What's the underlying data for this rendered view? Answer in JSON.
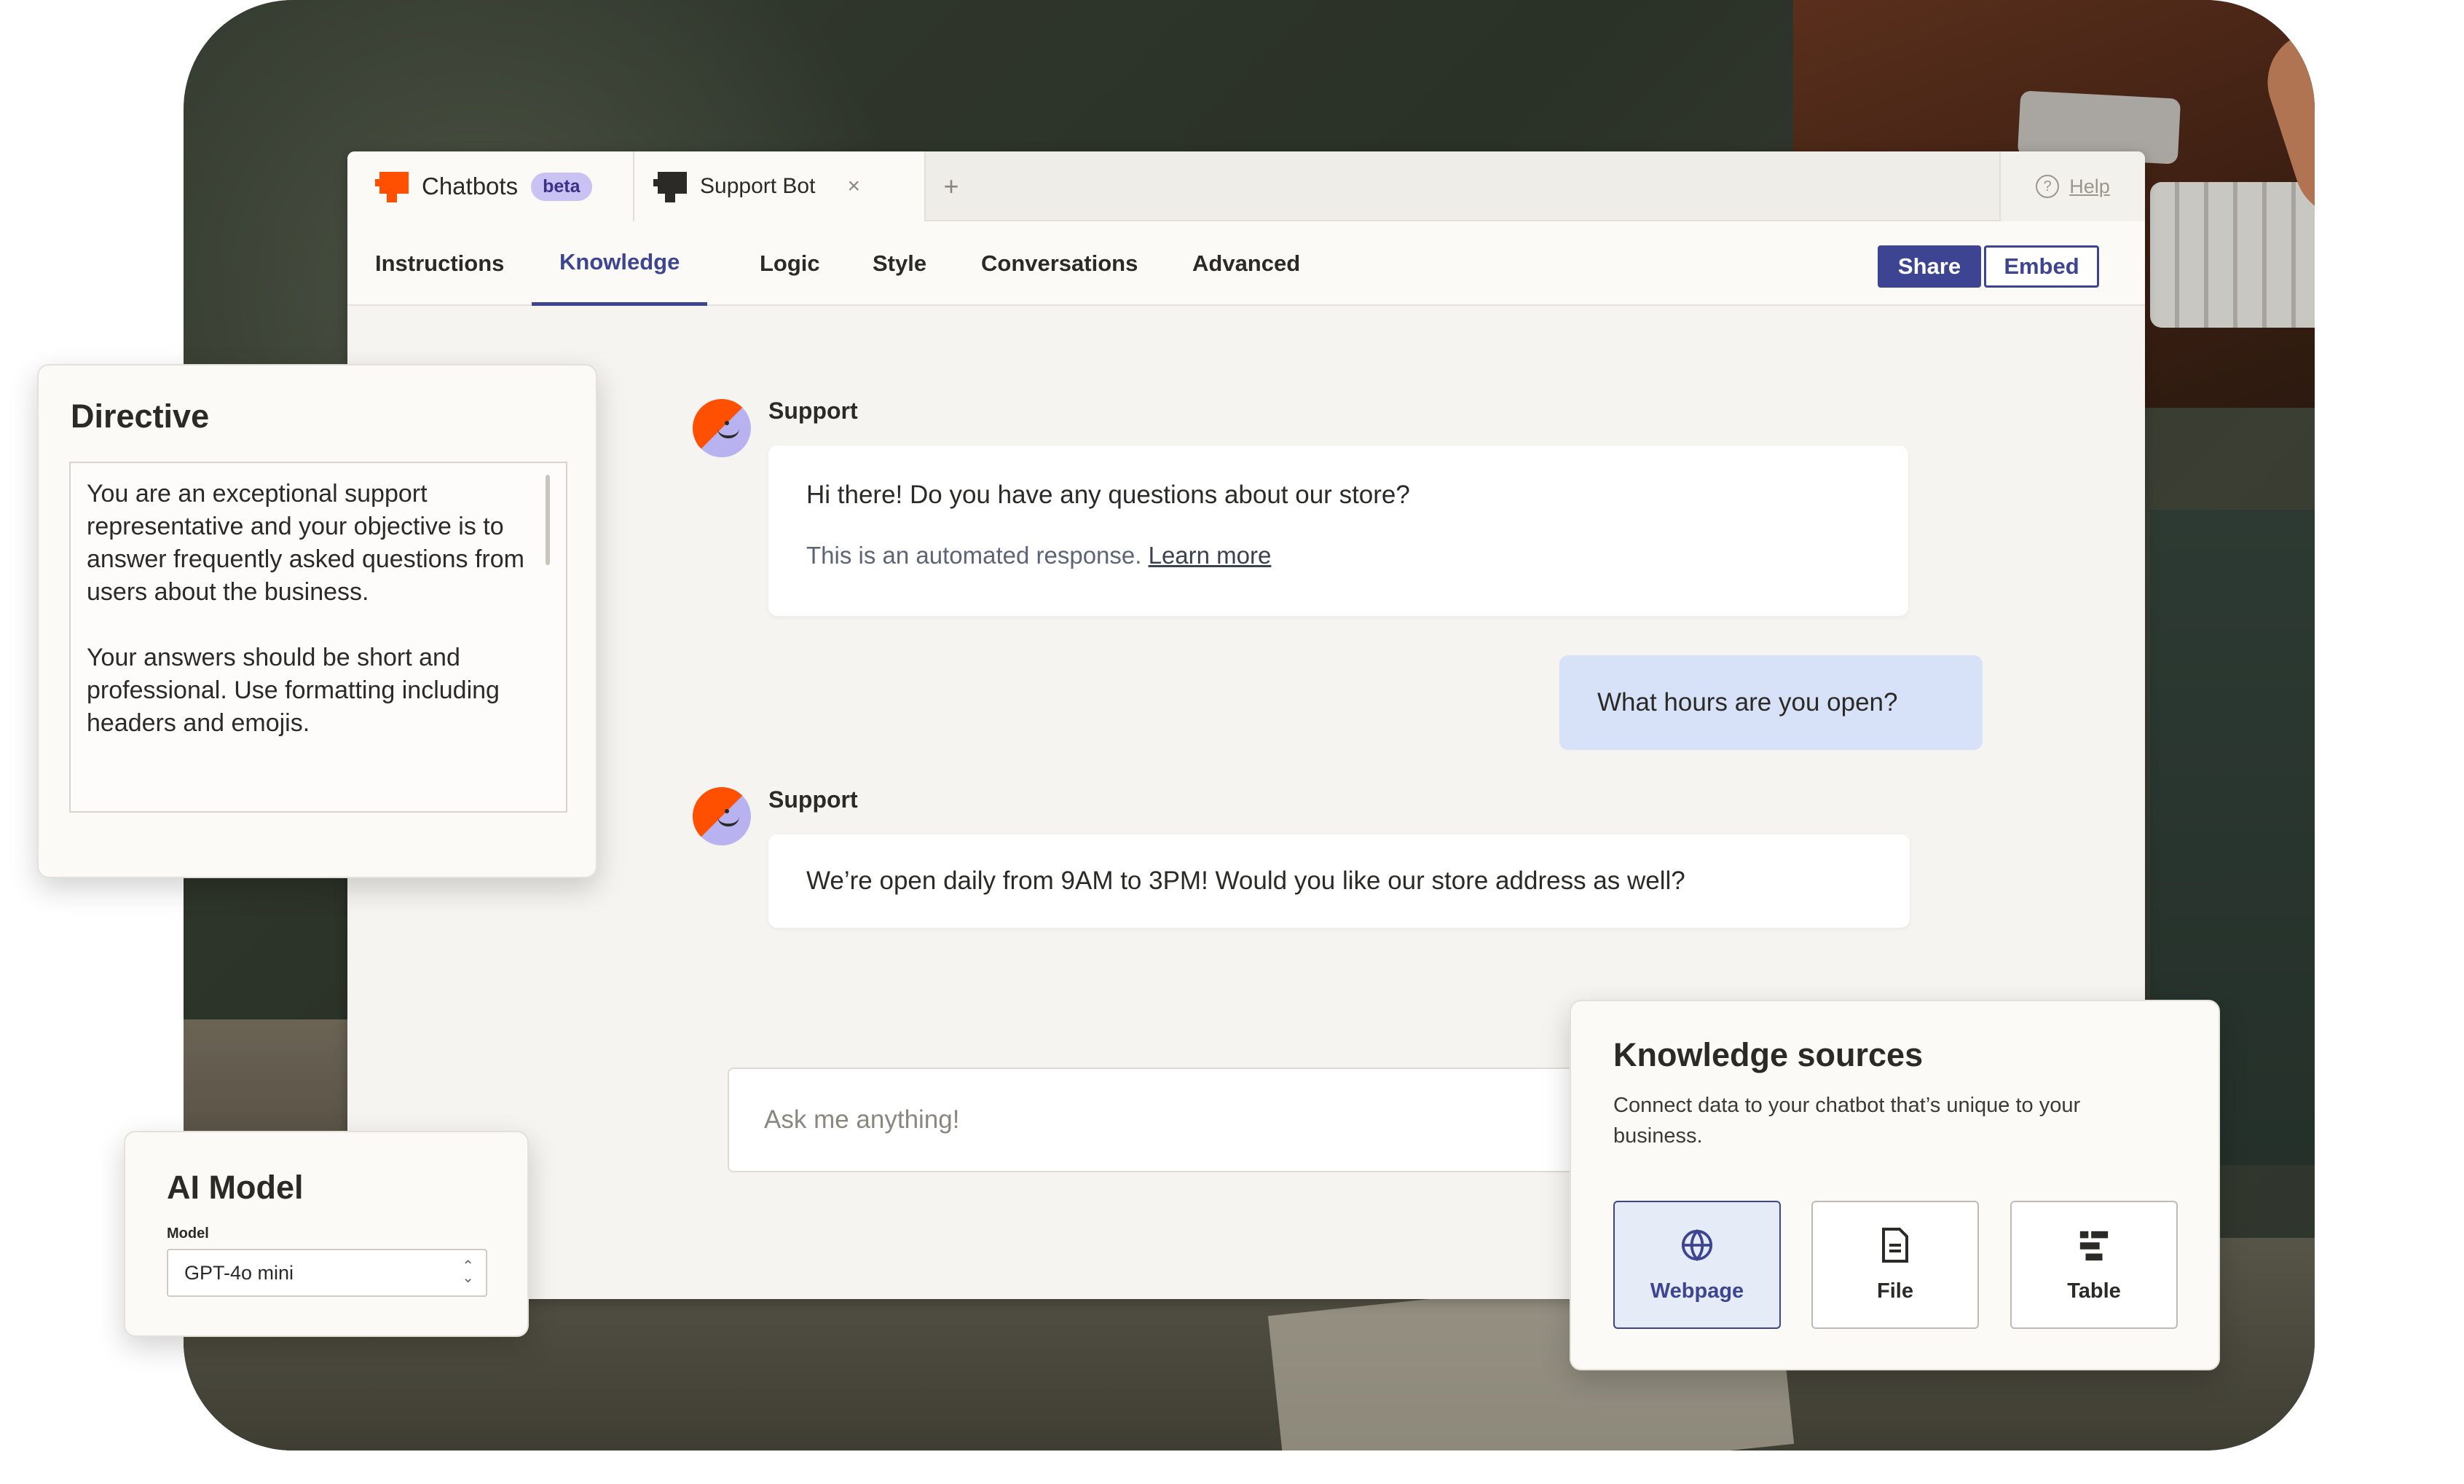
{
  "tabs": {
    "app_label": "Chatbots",
    "beta_badge": "beta",
    "bot_tab_label": "Support Bot",
    "close_symbol": "×",
    "add_symbol": "+",
    "help_label": "Help"
  },
  "nav": {
    "items": [
      "Instructions",
      "Knowledge",
      "Logic",
      "Style",
      "Conversations",
      "Advanced"
    ],
    "active": "Knowledge",
    "share_label": "Share",
    "embed_label": "Embed"
  },
  "chat": {
    "messages": [
      {
        "sender": "Support",
        "text": "Hi there! Do you have any questions about our store?",
        "note": "This is an automated response.",
        "note_link": "Learn more"
      },
      {
        "sender": "user",
        "text": "What hours are you open?"
      },
      {
        "sender": "Support",
        "text": "We’re open daily from 9AM to 3PM! Would you like our store address as well?"
      }
    ],
    "input_placeholder": "Ask me anything!"
  },
  "directive": {
    "title": "Directive",
    "text": "You are an exceptional support representative and your objective is to answer frequently asked questions from users about the business.\n\nYour answers should be short and professional. Use formatting including headers and emojis."
  },
  "ai_model": {
    "title": "AI Model",
    "field_label": "Model",
    "selected": "GPT-4o mini"
  },
  "knowledge_sources": {
    "title": "Knowledge sources",
    "description": "Connect data to your chatbot that’s unique to your business.",
    "options": [
      "Webpage",
      "File",
      "Table"
    ],
    "selected": "Webpage"
  },
  "colors": {
    "accent": "#3d4592",
    "brand_orange": "#ff4f00",
    "beta_badge": "#c9c3f4",
    "user_bubble": "#d7e2f8"
  }
}
